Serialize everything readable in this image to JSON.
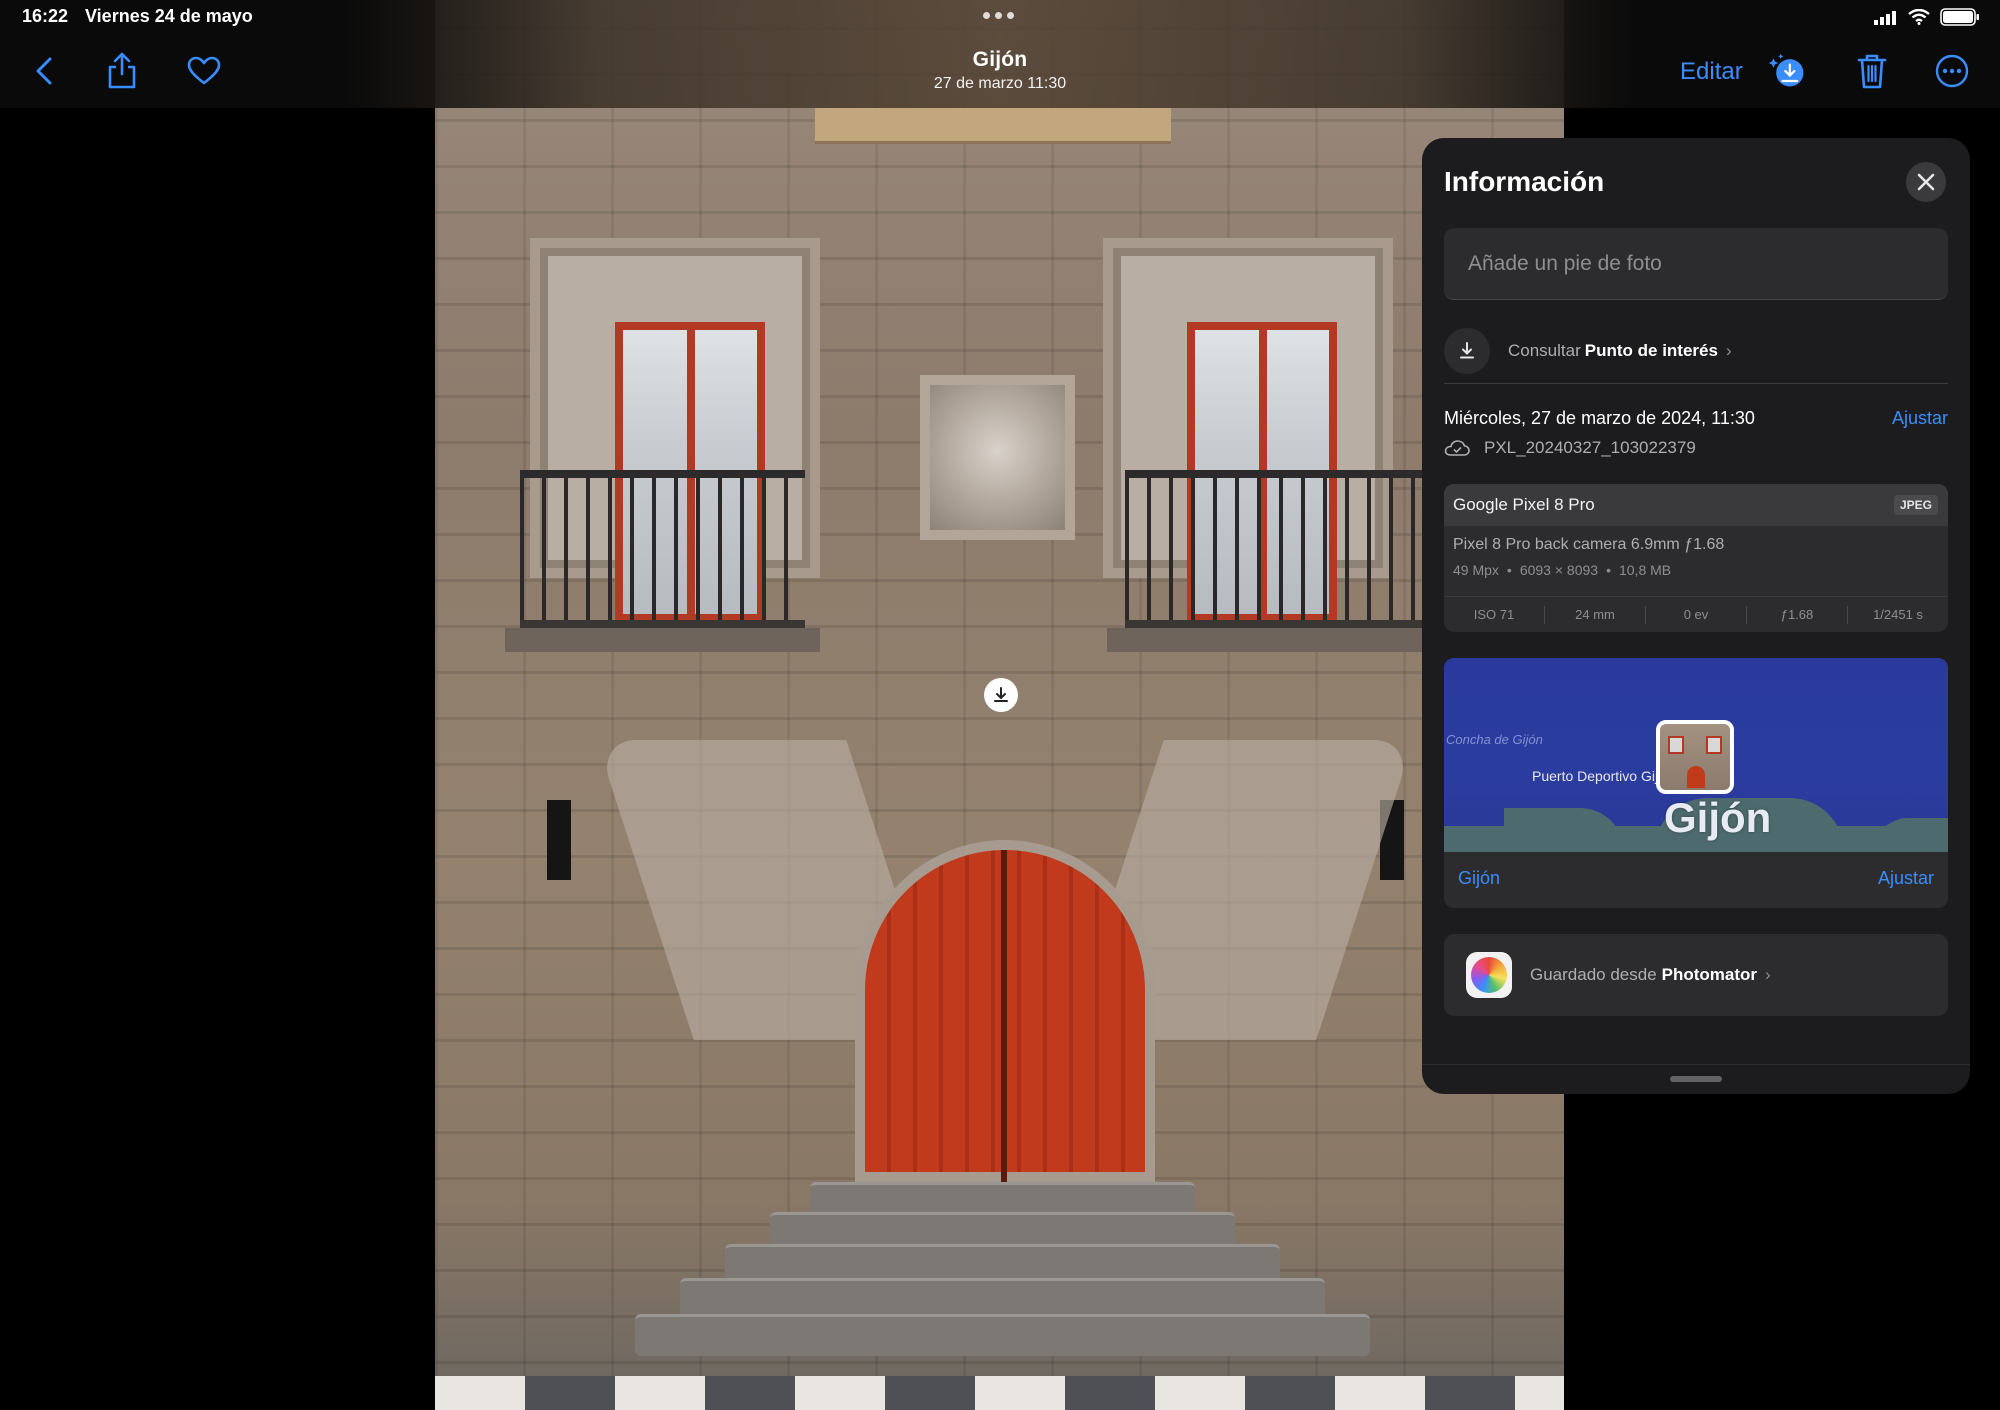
{
  "status_bar": {
    "time": "16:22",
    "date": "Viernes 24 de mayo"
  },
  "toolbar": {
    "title": "Gijón",
    "subtitle": "27 de marzo  11:30",
    "edit_label": "Editar",
    "accent_color": "#3a8dff"
  },
  "info_panel": {
    "title": "Información",
    "caption_placeholder": "Añade un pie de foto",
    "poi": {
      "prefix": "Consultar",
      "label": "Punto de interés"
    },
    "date_line": "Miércoles, 27 de marzo de 2024, 11:30",
    "adjust_label": "Ajustar",
    "file_name": "PXL_20240327_103022379",
    "camera": {
      "model": "Google Pixel 8 Pro",
      "format": "JPEG",
      "lens": "Pixel 8 Pro back camera 6.9mm ƒ1.68",
      "megapixels": "49 Mpx",
      "dimensions": "6093 × 8093",
      "file_size": "10,8 MB",
      "exif": [
        "ISO 71",
        "24 mm",
        "0 ev",
        "ƒ1.68",
        "1/2451 s"
      ]
    },
    "map": {
      "label_concha": "Concha de Gijón",
      "label_port": "Puerto Deportivo Gijón",
      "city_big": "Gijón",
      "footer_place": "Gijón",
      "footer_adjust": "Ajustar"
    },
    "saved_from": {
      "prefix": "Guardado desde",
      "app": "Photomator"
    }
  }
}
